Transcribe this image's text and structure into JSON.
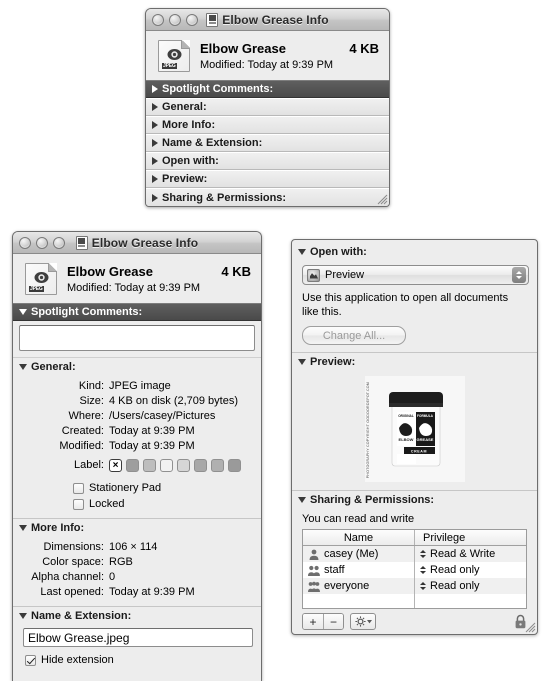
{
  "windows": {
    "collapsed": {
      "title": "Elbow Grease Info",
      "file": {
        "name": "Elbow Grease",
        "modified": "Modified: Today at 9:39 PM",
        "size": "4 KB",
        "icon_kind": "jpeg-document-icon",
        "icon_label": "JPEG"
      },
      "sections": [
        {
          "label": "Spotlight Comments:",
          "expanded": false,
          "highlighted": true
        },
        {
          "label": "General:",
          "expanded": false,
          "highlighted": false
        },
        {
          "label": "More Info:",
          "expanded": false,
          "highlighted": false
        },
        {
          "label": "Name & Extension:",
          "expanded": false,
          "highlighted": false
        },
        {
          "label": "Open with:",
          "expanded": false,
          "highlighted": false
        },
        {
          "label": "Preview:",
          "expanded": false,
          "highlighted": false
        },
        {
          "label": "Sharing & Permissions:",
          "expanded": false,
          "highlighted": false
        }
      ]
    },
    "expanded_left": {
      "title": "Elbow Grease Info",
      "file": {
        "name": "Elbow Grease",
        "modified": "Modified: Today at 9:39 PM",
        "size": "4 KB",
        "icon_label": "JPEG"
      },
      "spotlight": {
        "label": "Spotlight Comments:",
        "value": "",
        "placeholder": ""
      },
      "general": {
        "label": "General:",
        "rows": [
          {
            "key": "Kind:",
            "value": "JPEG image"
          },
          {
            "key": "Size:",
            "value": "4 KB on disk (2,709 bytes)"
          },
          {
            "key": "Where:",
            "value": "/Users/casey/Pictures"
          },
          {
            "key": "Created:",
            "value": "Today at 9:39 PM"
          },
          {
            "key": "Modified:",
            "value": "Today at 9:39 PM"
          }
        ],
        "label_row_key": "Label:",
        "label_swatches": [
          {
            "name": "none",
            "color": "#ffffff",
            "selected": true,
            "glyph": "×"
          },
          {
            "name": "swatch-1",
            "color": "#9e9e9e",
            "selected": false
          },
          {
            "name": "swatch-2",
            "color": "#bdbdbd",
            "selected": false
          },
          {
            "name": "swatch-3",
            "color": "#f2f2f2",
            "selected": false
          },
          {
            "name": "swatch-4",
            "color": "#d6d6d6",
            "selected": false
          },
          {
            "name": "swatch-5",
            "color": "#a8a8a8",
            "selected": false
          },
          {
            "name": "swatch-6",
            "color": "#b0b0b0",
            "selected": false
          },
          {
            "name": "swatch-7",
            "color": "#9a9a9a",
            "selected": false
          }
        ],
        "checkboxes": [
          {
            "label": "Stationery Pad",
            "checked": false
          },
          {
            "label": "Locked",
            "checked": false
          }
        ]
      },
      "more_info": {
        "label": "More Info:",
        "rows": [
          {
            "key": "Dimensions:",
            "value": "106 × 114"
          },
          {
            "key": "Color space:",
            "value": "RGB"
          },
          {
            "key": "Alpha channel:",
            "value": "0"
          },
          {
            "key": "Last opened:",
            "value": "Today at 9:39 PM"
          }
        ]
      },
      "name_extension": {
        "label": "Name & Extension:",
        "filename": "Elbow Grease.jpeg",
        "hide_extension": {
          "label": "Hide extension",
          "checked": true
        }
      }
    },
    "right_panel": {
      "open_with": {
        "label": "Open with:",
        "selected_app": "Preview",
        "app_icon": "preview-app-icon",
        "help_text": "Use this application to open all documents like this.",
        "change_all_button": "Change All...",
        "change_all_enabled": false
      },
      "preview": {
        "label": "Preview:",
        "image_alt": "Elbow Grease Cream jar product photo",
        "image_side_caption": "PHOTOGRAPHY COPYRIGHT OODOORDEPOT.COM",
        "jar_text": {
          "top_left": "ORIGINAL",
          "top_right": "FORMULA",
          "brand_line_1": "ELBOW",
          "brand_line_2": "GREASE",
          "bottom": "CREAM"
        }
      },
      "sharing": {
        "label": "Sharing & Permissions:",
        "summary": "You can read and write",
        "columns": [
          "Name",
          "Privilege"
        ],
        "rows": [
          {
            "icon": "person-icon",
            "name": "casey (Me)",
            "privilege": "Read & Write"
          },
          {
            "icon": "group-icon",
            "name": "staff",
            "privilege": "Read only"
          },
          {
            "icon": "group-icon",
            "name": "everyone",
            "privilege": "Read only"
          }
        ],
        "toolbar": {
          "add_button": "+",
          "remove_button": "−",
          "action_button": "gear-icon",
          "lock_button": "lock-icon"
        }
      }
    }
  }
}
